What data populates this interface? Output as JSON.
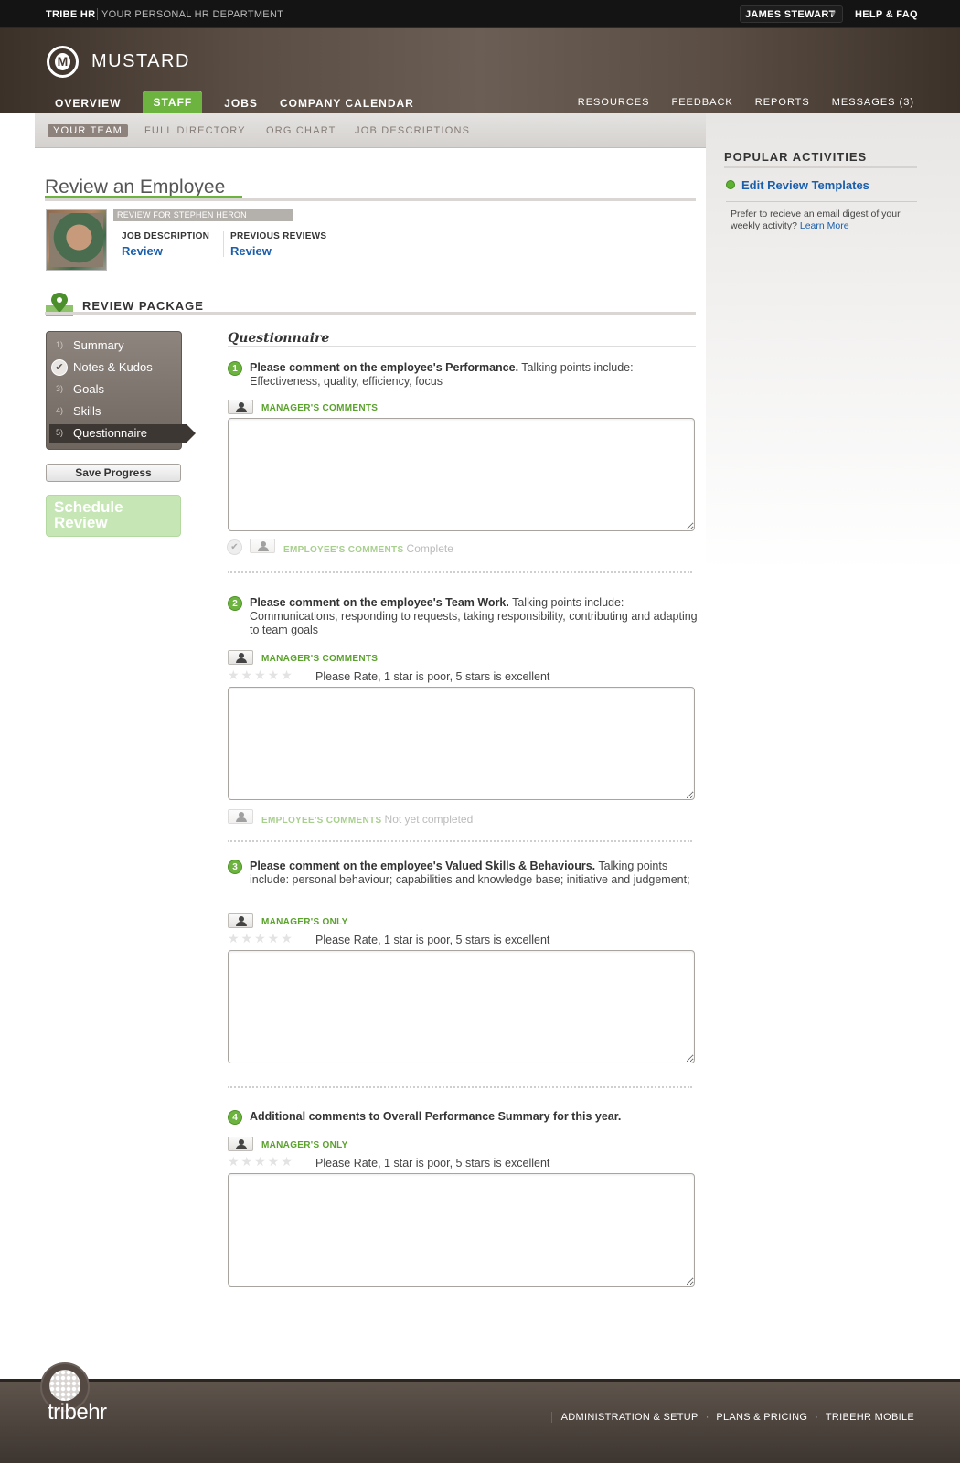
{
  "topbar": {
    "brand": "TRIBE HR",
    "tagline": "YOUR PERSONAL HR DEPARTMENT",
    "user": "JAMES STEWART",
    "help": "HELP & FAQ"
  },
  "header": {
    "logo_letter": "M",
    "company": "MUSTARD",
    "nav": [
      "OVERVIEW",
      "STAFF",
      "JOBS",
      "COMPANY CALENDAR"
    ],
    "active_nav": "STAFF",
    "right_nav": [
      "RESOURCES",
      "FEEDBACK",
      "REPORTS",
      "MESSAGES (3)"
    ]
  },
  "subnav": {
    "items": [
      "YOUR TEAM",
      "FULL DIRECTORY",
      "ORG CHART",
      "JOB DESCRIPTIONS"
    ],
    "active": "YOUR TEAM"
  },
  "page": {
    "title": "Review an Employee",
    "review_for": "REVIEW FOR STEPHEN HERON",
    "job_description_label": "JOB DESCRIPTION",
    "job_description_link": "Review",
    "previous_reviews_label": "PREVIOUS REVIEWS",
    "previous_reviews_link": "Review",
    "package_title": "REVIEW PACKAGE"
  },
  "steps": [
    {
      "num": "1)",
      "label": "Summary"
    },
    {
      "num": "",
      "label": "Notes & Kudos",
      "done": true
    },
    {
      "num": "3)",
      "label": "Goals"
    },
    {
      "num": "4)",
      "label": "Skills"
    },
    {
      "num": "5)",
      "label": "Questionnaire",
      "active": true
    }
  ],
  "buttons": {
    "save": "Save Progress",
    "schedule_line1": "Schedule",
    "schedule_line2": "Review"
  },
  "questionnaire": {
    "title": "Questionnaire",
    "rate_text": "Please Rate, 1 star is poor, 5 stars is excellent",
    "stars": "★★★★★",
    "questions": [
      {
        "num": "1",
        "bold": "Please comment on the employee's Performance.",
        "rest": " Talking points include: Effectiveness, quality, efficiency, focus",
        "role": "MANAGER'S COMMENTS",
        "employee_label": "EMPLOYEE'S COMMENTS",
        "employee_status": "Complete"
      },
      {
        "num": "2",
        "bold": "Please comment on the employee's Team Work.",
        "rest": " Talking points include: Communications, responding to requests, taking responsibility, contributing and adapting to team goals",
        "role": "MANAGER'S COMMENTS",
        "employee_label": "EMPLOYEE'S COMMENTS",
        "employee_status": "Not yet completed"
      },
      {
        "num": "3",
        "bold": "Please comment on the employee's Valued Skills & Behaviours.",
        "rest": " Talking points include: personal behaviour; capabilities and knowledge base; initiative and judgement;",
        "role": "MANAGER'S ONLY"
      },
      {
        "num": "4",
        "bold": "Additional comments to Overall Performance Summary for this year.",
        "rest": "",
        "role": "MANAGER'S ONLY"
      }
    ]
  },
  "sidebar": {
    "title": "POPULAR ACTIVITIES",
    "activity": "Edit Review Templates",
    "note": "Prefer to recieve an email digest of your weekly activity?",
    "note_link": "Learn More"
  },
  "footer": {
    "brand": "tribehr",
    "links": [
      "ADMINISTRATION & SETUP",
      "PLANS & PRICING",
      "TRIBEHR MOBILE"
    ]
  },
  "colors": {
    "accent_green": "#6cb33f",
    "link_blue": "#1a5fab",
    "header_brown": "#5a4d43"
  }
}
